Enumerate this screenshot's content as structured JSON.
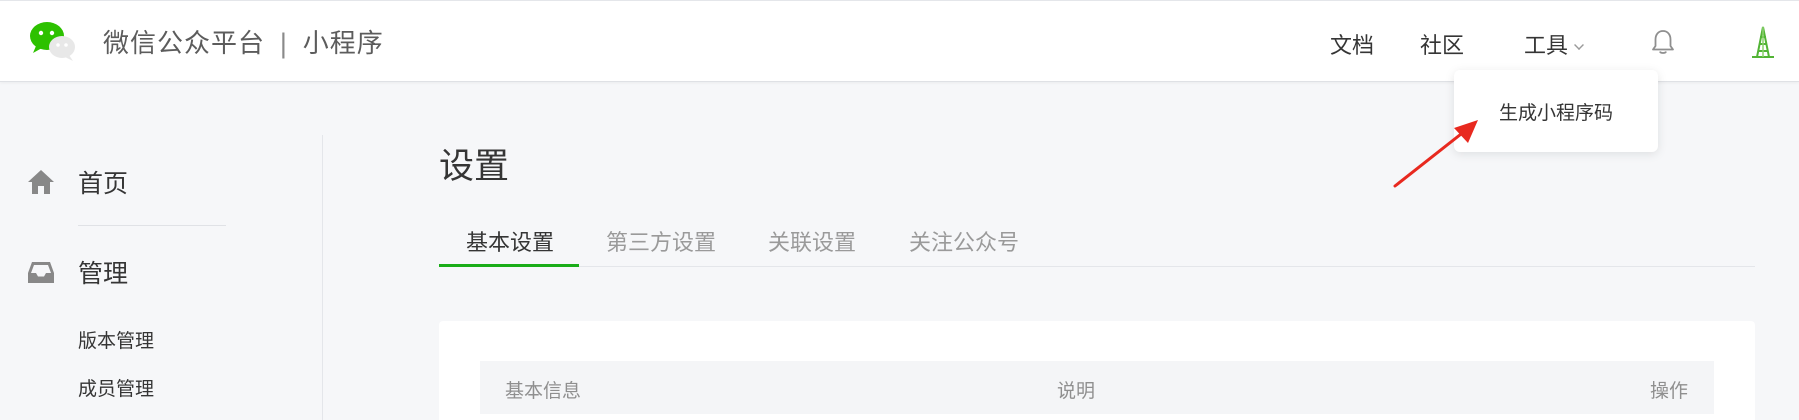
{
  "header": {
    "brand_name": "微信公众平台",
    "brand_separator": "|",
    "brand_sub": "小程序",
    "nav": {
      "docs": "文档",
      "community": "社区",
      "tools": "工具"
    },
    "icons": [
      "wechat-logo-icon",
      "chevron-down-icon",
      "bell-icon",
      "avatar-icon"
    ]
  },
  "dropdown": {
    "items": [
      {
        "label": "生成小程序码"
      }
    ]
  },
  "annotation": {
    "arrow_color": "#e8291f"
  },
  "sidebar": {
    "items": [
      {
        "label": "首页",
        "icon": "home-icon"
      },
      {
        "label": "管理",
        "icon": "inbox-icon"
      }
    ],
    "sub_items": [
      {
        "label": "版本管理"
      },
      {
        "label": "成员管理"
      }
    ]
  },
  "main": {
    "title": "设置",
    "tabs": [
      {
        "label": "基本设置",
        "active": true
      },
      {
        "label": "第三方设置",
        "active": false
      },
      {
        "label": "关联设置",
        "active": false
      },
      {
        "label": "关注公众号",
        "active": false
      }
    ],
    "table": {
      "columns": [
        "基本信息",
        "说明",
        "操作"
      ]
    }
  },
  "colors": {
    "accent": "#1aad19",
    "background": "#f6f7f9",
    "text": "#353535",
    "muted": "#9a9a9a"
  }
}
